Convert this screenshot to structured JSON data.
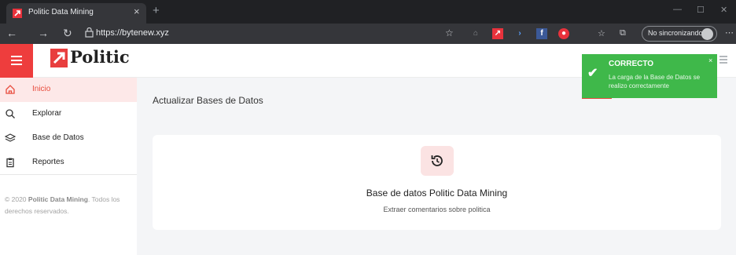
{
  "browser": {
    "tab_title": "Politic Data Mining",
    "tab_close": "×",
    "new_tab": "+",
    "url": "https://bytenew.xyz",
    "sync_label": "No sincronizando",
    "window_controls": [
      "—",
      "☐",
      "✕"
    ]
  },
  "header": {
    "logo_text": "Politic",
    "accent_color": "#e84c3d"
  },
  "sidebar": {
    "items": [
      {
        "label": "Inicio",
        "icon": "home-icon",
        "active": true
      },
      {
        "label": "Explorar",
        "icon": "search-icon",
        "active": false
      },
      {
        "label": "Base de Datos",
        "icon": "layers-icon",
        "active": false
      },
      {
        "label": "Reportes",
        "icon": "clipboard-icon",
        "active": false
      }
    ],
    "copyright_prefix": "© 2020 ",
    "copyright_brand": "Politic Data Mining",
    "copyright_suffix": ". Todos los derechos reservados."
  },
  "main": {
    "page_title": "Actualizar Bases de Datos",
    "card_title": "Base de datos Politic Data Mining",
    "card_subtitle": "Extraer comentarios sobre politica"
  },
  "toast": {
    "title": "CORRECTO",
    "message": "La carga de la Base de Datos se realizo correctamente",
    "close": "×",
    "color": "#3fb84a"
  }
}
